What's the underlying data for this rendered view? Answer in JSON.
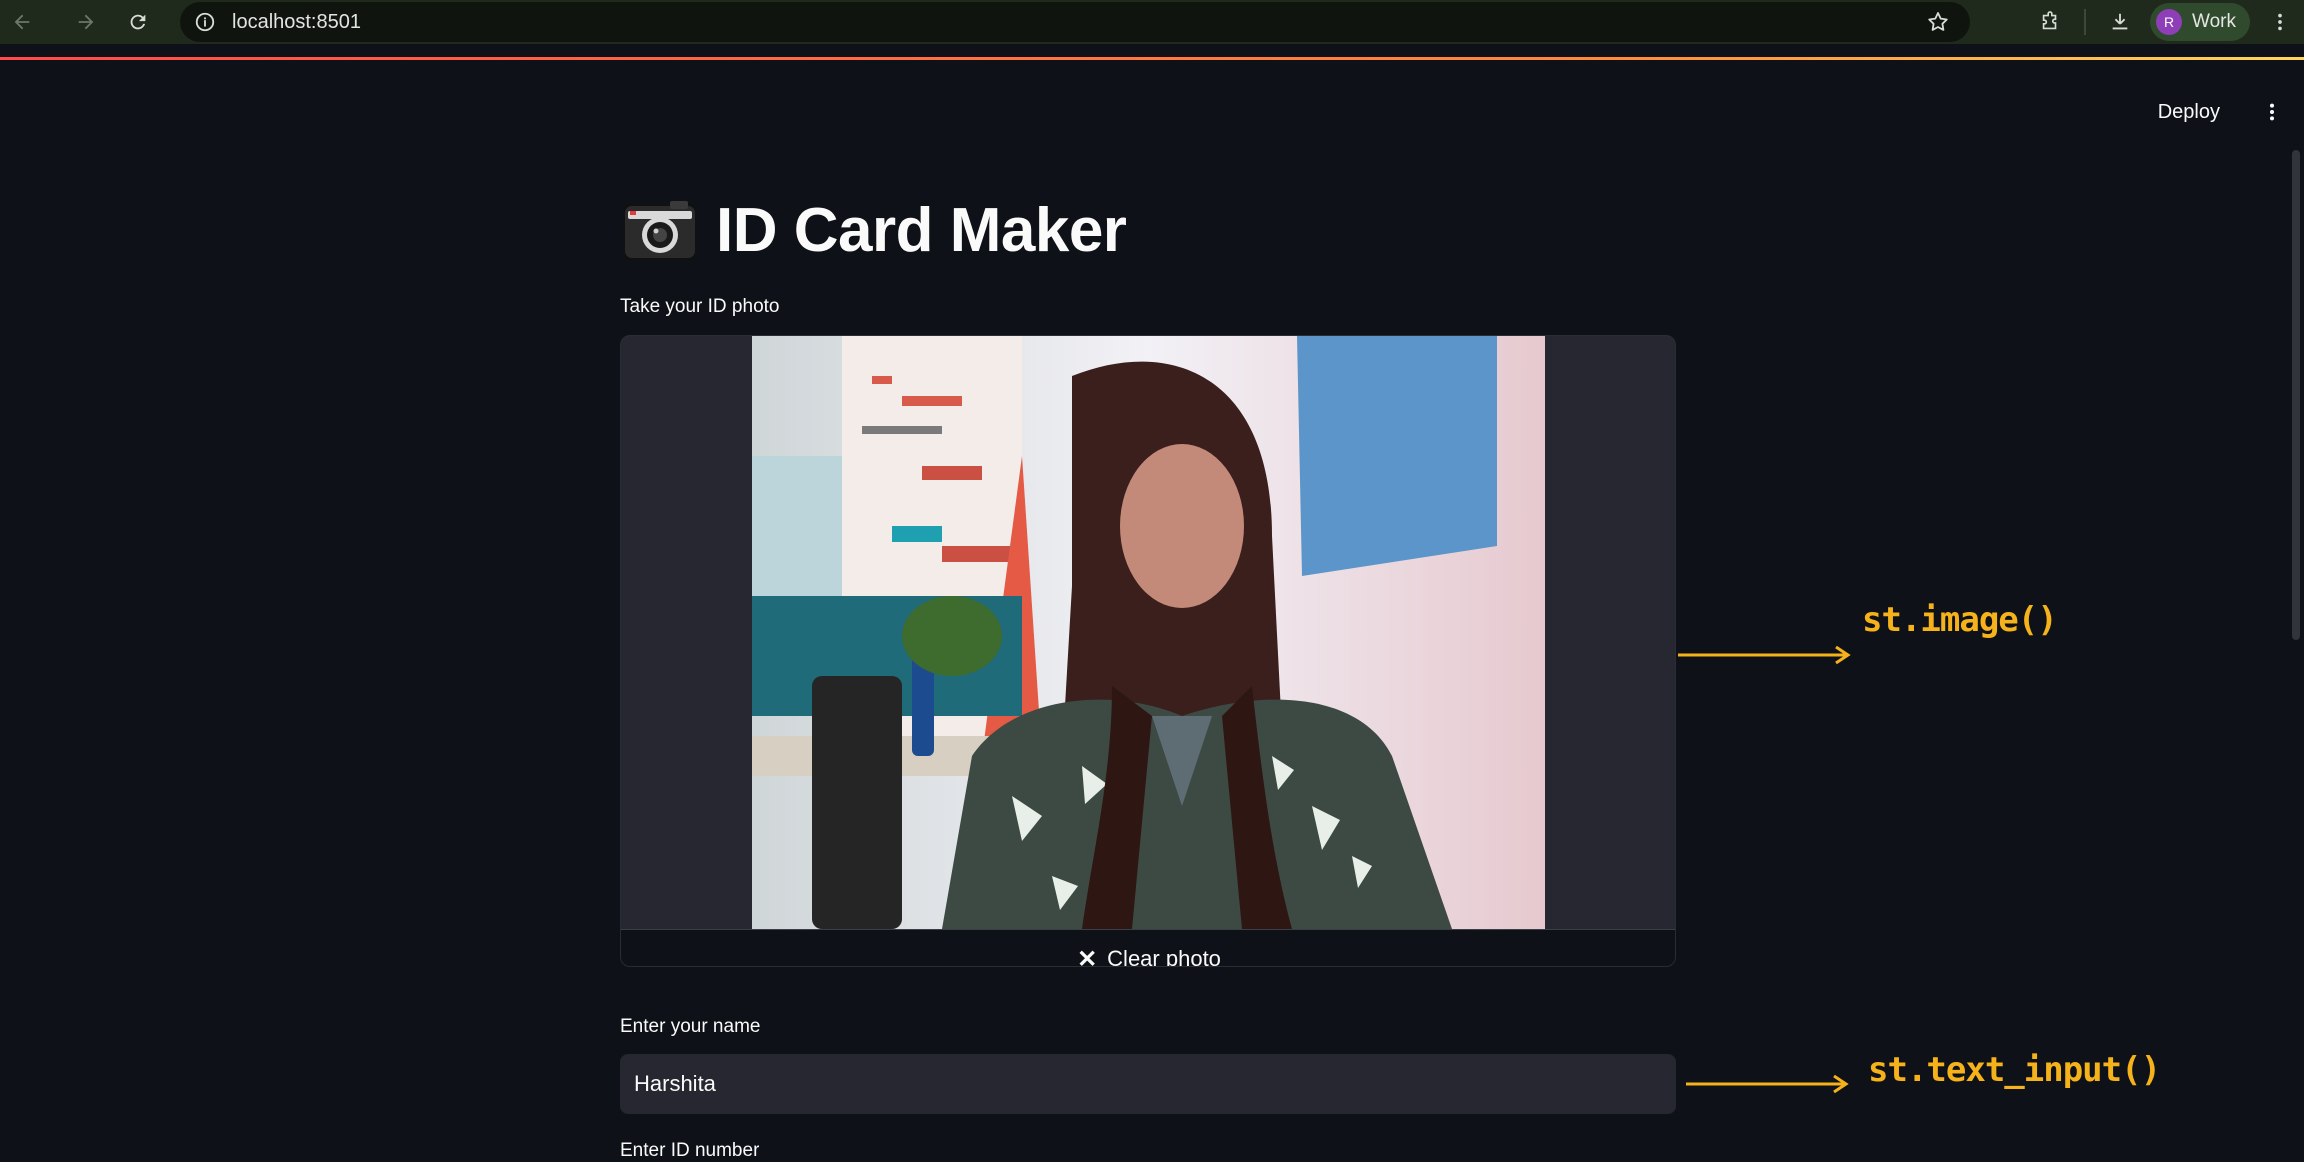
{
  "browser": {
    "url": "localhost:8501",
    "profile_initial": "R",
    "profile_name": "Work",
    "icons": [
      "back-icon",
      "forward-icon",
      "reload-icon",
      "site-info-icon",
      "bookmark-star-icon",
      "extensions-icon",
      "download-icon",
      "menu-icon"
    ]
  },
  "app": {
    "deploy_label": "Deploy",
    "title": "ID Card Maker",
    "title_icon": "camera-icon",
    "camera_label": "Take your ID photo",
    "clear_photo_label": "Clear photo",
    "name_label": "Enter your name",
    "name_value": "Harshita",
    "next_label_partial": "Enter ID number"
  },
  "annotations": {
    "image": "st.image()",
    "text_input": "st.text_input()"
  },
  "colors": {
    "background": "#0e1117",
    "widget_bg": "#262730",
    "accent_line": "#ff4b4b",
    "annotation": "#f5b21b"
  }
}
